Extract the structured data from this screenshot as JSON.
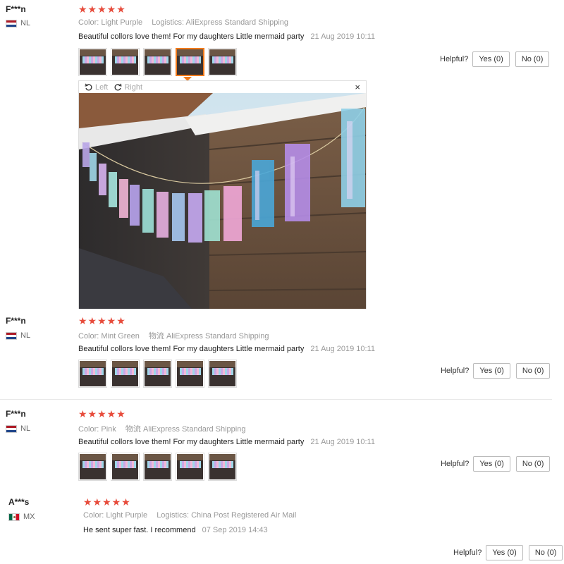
{
  "reviews": [
    {
      "name": "F***n",
      "country": "NL",
      "stars": "★★★★★",
      "color_key": "Color:",
      "color_val": "Light Purple",
      "ship_key": "Logistics:",
      "ship_val": "AliExpress Standard Shipping",
      "text": "Beautiful collors love them! For my daughters Little mermaid party",
      "date": "21 Aug 2019 10:11",
      "helpful": "Helpful?",
      "yes": "Yes (0)",
      "no": "No (0)"
    },
    {
      "name": "F***n",
      "country": "NL",
      "stars": "★★★★★",
      "color_key": "Color:",
      "color_val": "Mint Green",
      "ship_key": "物流",
      "ship_val": "AliExpress Standard Shipping",
      "text": "Beautiful collors love them! For my daughters Little mermaid party",
      "date": "21 Aug 2019 10:11",
      "helpful": "Helpful?",
      "yes": "Yes (0)",
      "no": "No (0)"
    },
    {
      "name": "F***n",
      "country": "NL",
      "stars": "★★★★★",
      "color_key": "Color:",
      "color_val": "Pink",
      "ship_key": "物流",
      "ship_val": "AliExpress Standard Shipping",
      "text": "Beautiful collors love them! For my daughters Little mermaid party",
      "date": "21 Aug 2019 10:11",
      "helpful": "Helpful?",
      "yes": "Yes (0)",
      "no": "No (0)"
    },
    {
      "name": "A***s",
      "country": "MX",
      "stars": "★★★★★",
      "color_key": "Color:",
      "color_val": "Light Purple",
      "ship_key": "Logistics:",
      "ship_val": "China Post Registered Air Mail",
      "text": "He sent super fast. I recommend",
      "date": "07 Sep 2019 14:43",
      "helpful": "Helpful?",
      "yes": "Yes (0)",
      "no": "No (0)"
    }
  ],
  "viewer": {
    "left": "Left",
    "right": "Right",
    "close": "×"
  },
  "colors": {
    "star": "#e74c3c",
    "active_thumb": "#f07a1b"
  }
}
